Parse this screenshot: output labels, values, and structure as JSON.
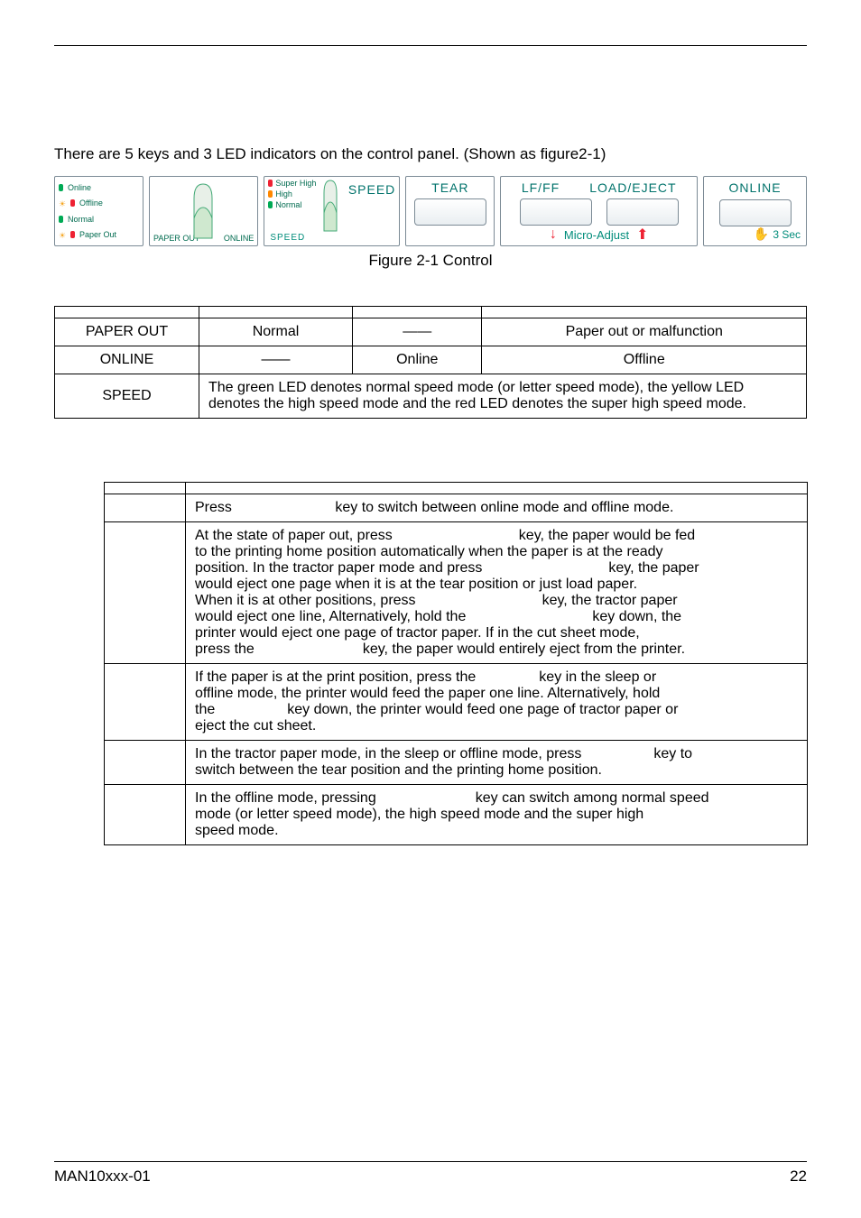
{
  "intro": "There are 5 keys and 3 LED indicators on the control panel. (Shown as figure2-1)",
  "panel": {
    "leds1": {
      "online": "Online",
      "offline": "Offline",
      "normal": "Normal",
      "paperout": "Paper Out"
    },
    "ponline": {
      "paperout": "PAPER OUT",
      "online": "ONLINE"
    },
    "speed": {
      "label": "SPEED",
      "caption": "SPEED",
      "super": "Super High",
      "high": "High",
      "normal": "Normal"
    },
    "tear": "TEAR",
    "lfff": "LF/FF",
    "loadeject": "LOAD/EJECT",
    "micro": "Micro-Adjust",
    "onlineKey": "ONLINE",
    "sec": "3 Sec"
  },
  "caption": "Figure 2-1 Control",
  "ledTable": {
    "r1": {
      "c1": "PAPER OUT",
      "c2": "Normal",
      "c3": "——",
      "c4": "Paper out or malfunction"
    },
    "r2": {
      "c1": "ONLINE",
      "c2": "——",
      "c3": "Online",
      "c4": "Offline"
    },
    "r3": {
      "c1": "SPEED",
      "desc": "The green LED denotes normal speed mode (or letter speed mode), the yellow LED denotes the high speed mode and the red LED denotes the super high speed mode."
    }
  },
  "keyTable": {
    "r1": {
      "a": "Press",
      "b": "key to switch between online mode and offline mode."
    },
    "r2": {
      "l1a": "At the state of paper out, press",
      "l1b": "key, the paper would be fed",
      "l2": "to the printing home position automatically when the paper is at the ready",
      "l3a": "position. In the tractor paper mode and press",
      "l3b": "key, the paper",
      "l4": "would eject one page when it is at the tear position or just load paper.",
      "l5a": "When it is at other positions, press",
      "l5b": "key, the tractor paper",
      "l6a": "would eject one line, Alternatively, hold the",
      "l6b": "key down, the",
      "l7": "printer would eject one page of tractor paper. If in the cut sheet mode,",
      "l8a": "press the",
      "l8b": "key, the paper would entirely eject from the printer."
    },
    "r3": {
      "l1a": "If the paper is at the print position, press the",
      "l1b": "key in the sleep or",
      "l2": "offline mode, the printer would feed the paper one line. Alternatively, hold",
      "l3a": "the",
      "l3b": "key down, the printer would feed one page of tractor paper or",
      "l4": "eject the cut sheet."
    },
    "r4": {
      "l1a": "In the tractor paper mode, in the sleep or offline mode, press",
      "l1b": "key to",
      "l2": "switch between the tear position and the printing home position."
    },
    "r5": {
      "l1a": "In the offline mode, pressing",
      "l1b": "key can switch among normal speed",
      "l2": "mode (or letter speed mode), the high speed mode and the super high",
      "l3": "speed mode."
    }
  },
  "footer": {
    "left": "MAN10xxx-01",
    "right": "22"
  }
}
